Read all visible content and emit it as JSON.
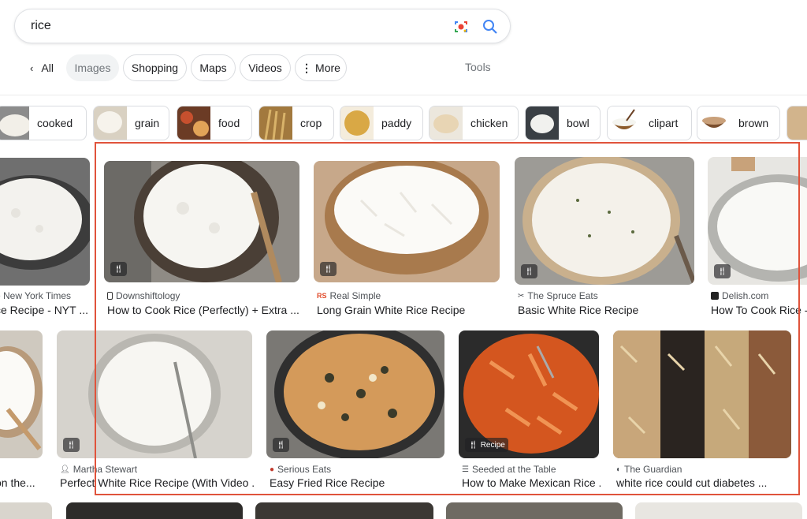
{
  "search": {
    "query": "rice"
  },
  "nav": {
    "tabs": [
      "All",
      "Images",
      "Shopping",
      "Maps",
      "Videos",
      "More"
    ],
    "tools": "Tools"
  },
  "chips": [
    "cooked",
    "grain",
    "food",
    "crop",
    "paddy",
    "chicken",
    "bowl",
    "clipart",
    "brown"
  ],
  "row1": [
    {
      "source": "e New York Times",
      "title": "ce Recipe - NYT ..."
    },
    {
      "source": "Downshiftology",
      "title": "How to Cook Rice (Perfectly) + Extra ..."
    },
    {
      "source": "Real Simple",
      "title": "Long Grain White Rice Recipe"
    },
    {
      "source": "The Spruce Eats",
      "title": "Basic White Rice Recipe"
    },
    {
      "source": "Delish.com",
      "title": "How To Cook Rice - ..."
    }
  ],
  "row2": [
    {
      "source": "",
      "title": "on the..."
    },
    {
      "source": "Martha Stewart",
      "title": "Perfect White Rice Recipe (With Video ..."
    },
    {
      "source": "Serious Eats",
      "title": "Easy Fried Rice Recipe"
    },
    {
      "source": "Seeded at the Table",
      "title": "How to Make Mexican Rice ..."
    },
    {
      "source": "The Guardian",
      "title": "white rice could cut diabetes ..."
    }
  ],
  "badge_recipe": "Recipe",
  "colors": {
    "highlight": "#e0533b",
    "chip_border": "#dadce0"
  }
}
